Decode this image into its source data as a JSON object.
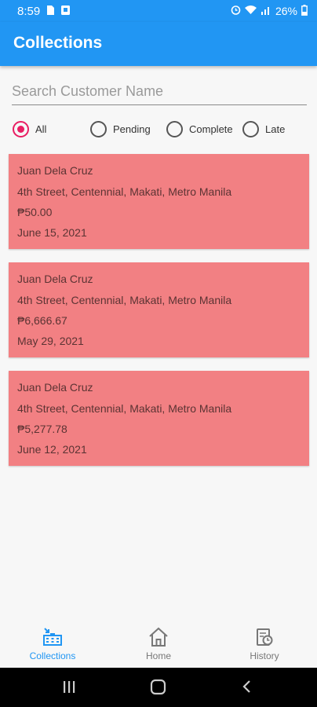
{
  "status_bar": {
    "time": "8:59",
    "battery": "26%"
  },
  "app_bar": {
    "title": "Collections"
  },
  "search": {
    "placeholder": "Search Customer Name",
    "value": ""
  },
  "filters": {
    "selected": "All",
    "options": [
      "All",
      "Pending",
      "Complete",
      "Late"
    ]
  },
  "colors": {
    "primary": "#2196f3",
    "card_background": "#f28083",
    "radio_accent": "#e91e63"
  },
  "collections": [
    {
      "name": "Juan Dela Cruz",
      "address": "4th Street, Centennial, Makati, Metro Manila",
      "amount": "₱50.00",
      "date": "June 15, 2021"
    },
    {
      "name": "Juan Dela Cruz",
      "address": "4th Street, Centennial, Makati, Metro Manila",
      "amount": "₱6,666.67",
      "date": "May 29, 2021"
    },
    {
      "name": "Juan Dela Cruz",
      "address": "4th Street, Centennial, Makati, Metro Manila",
      "amount": "₱5,277.78",
      "date": "June 12, 2021"
    }
  ],
  "bottom_nav": {
    "items": [
      {
        "label": "Collections",
        "icon": "collections-icon",
        "active": true
      },
      {
        "label": "Home",
        "icon": "home-icon",
        "active": false
      },
      {
        "label": "History",
        "icon": "history-icon",
        "active": false
      }
    ]
  },
  "system_nav": {
    "icons": [
      "recent-apps-icon",
      "home-button-icon",
      "back-icon"
    ]
  }
}
